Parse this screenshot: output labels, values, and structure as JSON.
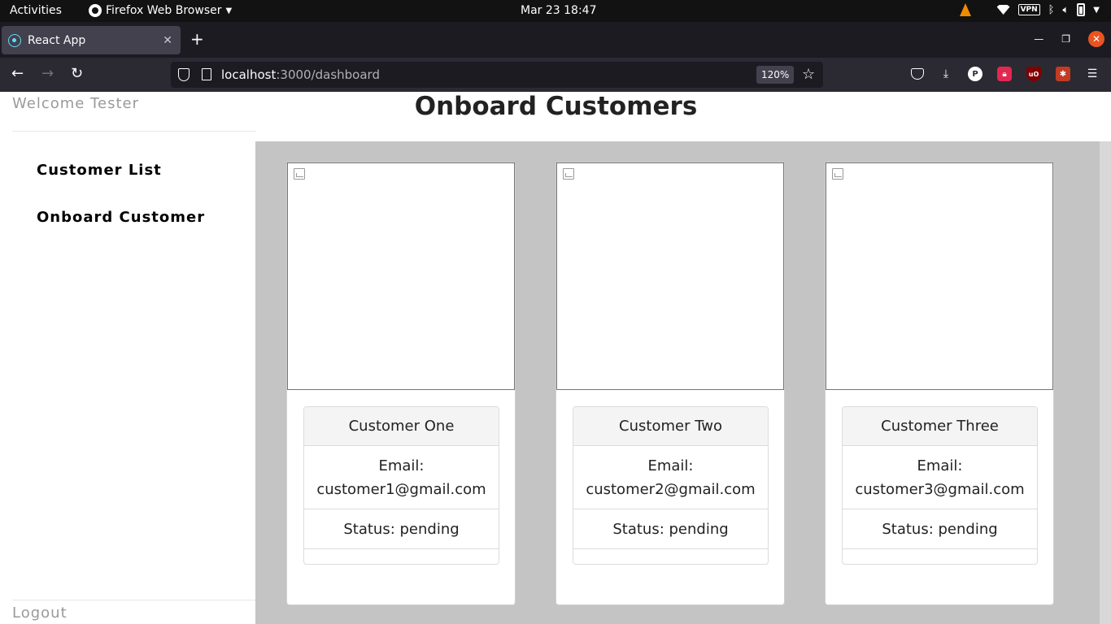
{
  "system": {
    "activities": "Activities",
    "app_menu": "Firefox Web Browser",
    "clock": "Mar 23  18:47",
    "tray_vpn": "VPN"
  },
  "browser": {
    "tab_title": "React App",
    "tab_close": "✕",
    "new_tab": "+",
    "url_host": "localhost",
    "url_path": ":3000/dashboard",
    "zoom": "120%",
    "pbadge": "P",
    "ublock": "uO",
    "icons": {
      "back": "back-arrow-icon",
      "forward": "forward-arrow-icon",
      "reload": "reload-icon",
      "menu": "hamburger-menu-icon"
    }
  },
  "sidebar": {
    "welcome": "Welcome Tester",
    "links": [
      "Customer List",
      "Onboard Customer"
    ],
    "logout": "Logout"
  },
  "main": {
    "title": "Onboard Customers",
    "cards": [
      {
        "name": "Customer One",
        "email_label": "Email:",
        "email": "customer1@gmail.com",
        "status": "Status: pending"
      },
      {
        "name": "Customer Two",
        "email_label": "Email:",
        "email": "customer2@gmail.com",
        "status": "Status: pending"
      },
      {
        "name": "Customer Three",
        "email_label": "Email:",
        "email": "customer3@gmail.com",
        "status": "Status: pending"
      }
    ]
  },
  "colors": {
    "content_bg": "#c4c4c4",
    "browser_chrome": "#2b2a33",
    "close_button": "#e95420"
  }
}
